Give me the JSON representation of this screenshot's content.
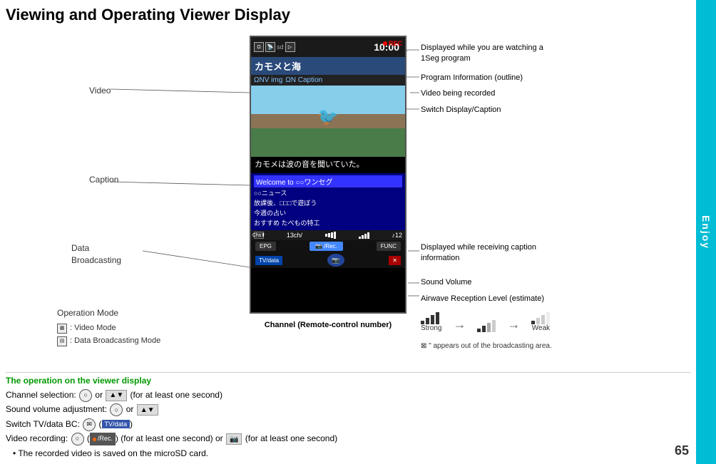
{
  "page": {
    "title": "Viewing and Operating Viewer Display",
    "page_number": "65",
    "enjoy_label": "Enjoy"
  },
  "phone_screen": {
    "time": "10:00",
    "title_text": "カモメと海",
    "toolbar_text": "ΩNV img ΩN Caption",
    "rec_label": "REC",
    "caption_text": "カモメは波の音を聞いていた。",
    "data_items": [
      "Welcome to ○○ワンセグ",
      "○○ニュース",
      "放課後、□□□で遊ぼう",
      "今週の占い",
      "おすすめ たべもの特工"
    ],
    "channel_label": "Channel (Remote-control number)"
  },
  "left_labels": {
    "video": "Video",
    "caption": "Caption",
    "data_broadcasting_line1": "Data",
    "data_broadcasting_line2": "Broadcasting",
    "operation_mode": "Operation Mode",
    "video_mode": ": Video Mode",
    "data_mode": ": Data Broadcasting Mode"
  },
  "right_labels": {
    "label_1seg_line1": "Displayed while you are watching a",
    "label_1seg_line2": "1Seg program",
    "program_info": "Program Information (outline)",
    "video_being_recorded": "Video being recorded",
    "switch_display": "Switch Display/Caption",
    "caption_info_line1": "Displayed while receiving caption",
    "caption_info_line2": "information",
    "sound_volume": "Sound Volume",
    "airwave": "Airwave Reception Level (estimate)",
    "strong_label": "Strong",
    "weak_label": "Weak",
    "out_of_area": "\"\" appears out of the broadcasting area."
  },
  "bottom_section": {
    "title": "The operation on the viewer display",
    "lines": [
      "Channel selection:  or  (for at least one second)",
      "Sound volume adjustment:  or ",
      "Switch TV/data BC:  ( )",
      "Video recording:   (  )(for at least one second) or  (for at least one second)",
      "• The recorded video is saved on the microSD card."
    ]
  }
}
